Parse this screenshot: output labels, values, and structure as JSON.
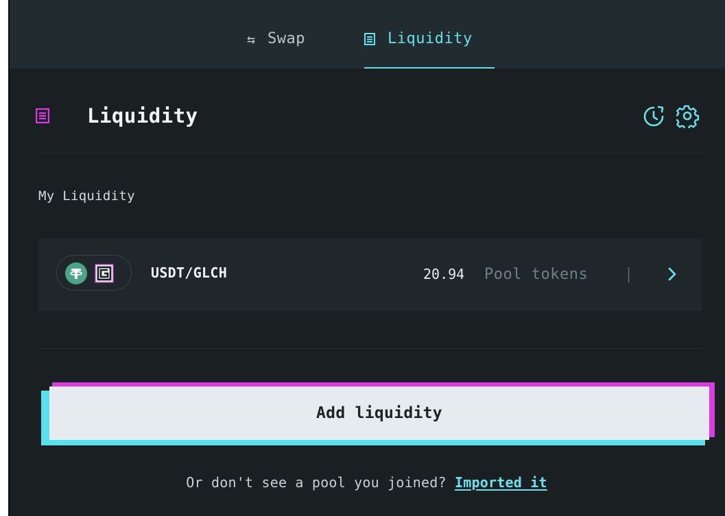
{
  "tabs": [
    {
      "label": "Swap",
      "icon": "swap-arrows-icon",
      "active": false
    },
    {
      "label": "Liquidity",
      "icon": "pool-icon",
      "active": true
    }
  ],
  "section": {
    "title": "Liquidity",
    "icon": "pool-icon",
    "actions": [
      {
        "icon": "history-icon"
      },
      {
        "icon": "gear-icon"
      }
    ]
  },
  "my_liquidity": {
    "label": "My Liquidity",
    "pools": [
      {
        "pair": "USDT/GLCH",
        "tokens": [
          "USDT",
          "GLCH"
        ],
        "amount": "20.94",
        "unit_label": "Pool tokens",
        "separator": "|"
      }
    ]
  },
  "add_button": {
    "label": "Add liquidity"
  },
  "footer": {
    "prompt": "Or don't see a pool you joined?",
    "link": "Imported it"
  },
  "colors": {
    "accent_cyan": "#62e3ec",
    "accent_pink": "#d93be0",
    "panel_bg": "#1a1f22",
    "topbar_bg": "#222b30",
    "row_bg": "#20272b",
    "usdt_green": "#4aa587"
  }
}
